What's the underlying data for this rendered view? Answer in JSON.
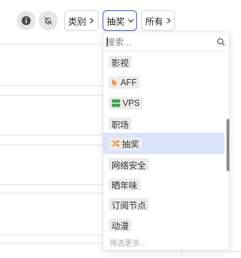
{
  "toolbar": {
    "info_icon": "info-circle-icon",
    "mute_icon": "bell-off-icon",
    "filters": [
      {
        "label": "类别",
        "icon": "chevron-right-icon"
      },
      {
        "label": "抽奖",
        "icon": "chevron-down-icon"
      },
      {
        "label": "所有",
        "icon": "chevron-right-icon"
      }
    ]
  },
  "dropdown": {
    "search": {
      "value": "",
      "placeholder": "搜索..."
    },
    "items": [
      {
        "label": "影视",
        "icon": ""
      },
      {
        "label": "AFF",
        "icon": "cursor-arrow-icon",
        "icon_color": "#f28c28"
      },
      {
        "label": "VPS",
        "icon": "server-icon",
        "icon_color": "#3aa542"
      },
      {
        "label": "职场",
        "icon": ""
      },
      {
        "label": "抽奖",
        "icon": "shuffle-icon",
        "icon_color": "#f28c28",
        "selected": true
      },
      {
        "label": "网络安全",
        "icon": ""
      },
      {
        "label": "晒年味",
        "icon": ""
      },
      {
        "label": "订阅节点",
        "icon": ""
      },
      {
        "label": "动漫",
        "icon": ""
      }
    ],
    "more_label": "筛选更多..."
  },
  "colors": {
    "accent": "#2f4fd8",
    "selected_bg": "#dbe3fb",
    "tag_bg": "#ececec"
  }
}
